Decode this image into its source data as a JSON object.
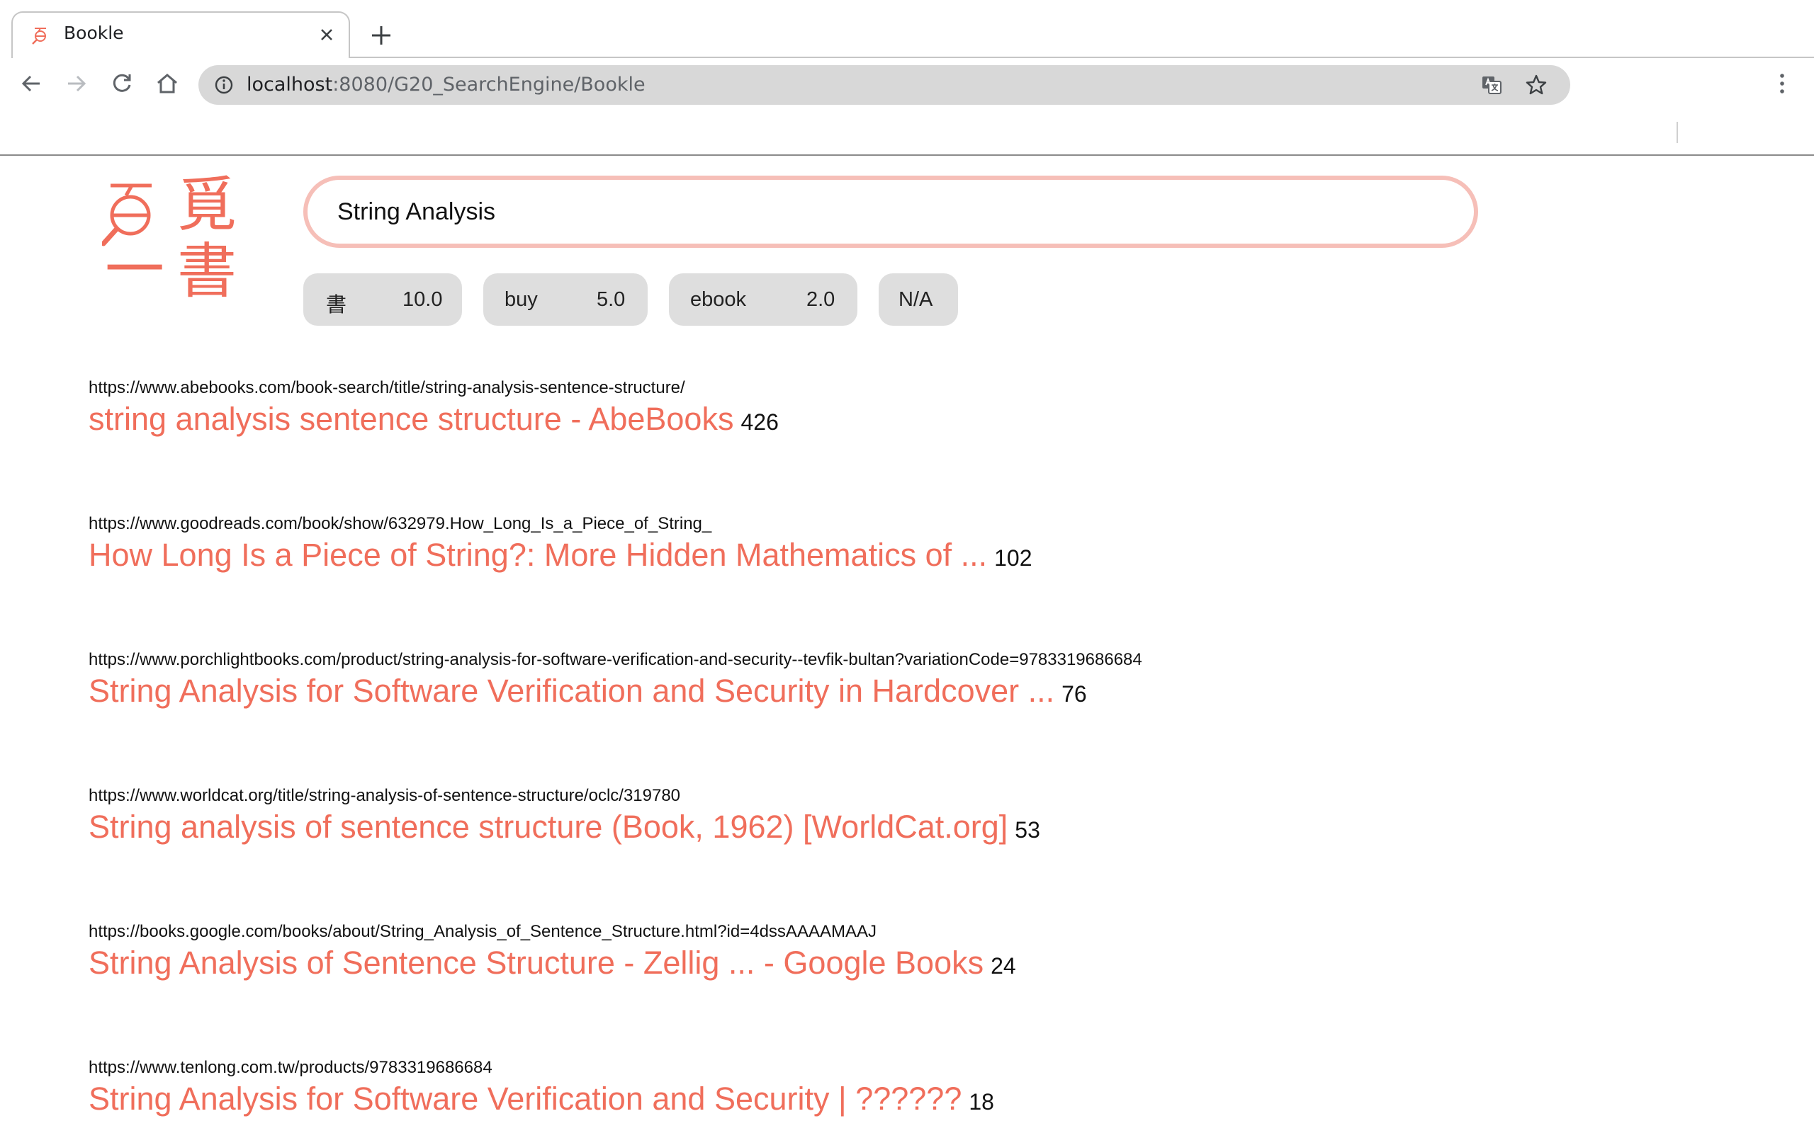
{
  "browser": {
    "tab_title": "Bookle",
    "url_host": "localhost",
    "url_rest": ":8080/G20_SearchEngine/Bookle"
  },
  "search": {
    "query": "String Analysis"
  },
  "logo": {
    "characters": [
      "覓",
      "一",
      "書"
    ],
    "color": "#f06e5b"
  },
  "weights": [
    {
      "label": "書",
      "value": "10.0"
    },
    {
      "label": "buy",
      "value": "5.0"
    },
    {
      "label": "ebook",
      "value": "2.0"
    },
    {
      "label": "N/A",
      "value": ""
    }
  ],
  "results": [
    {
      "url": "https://www.abebooks.com/book-search/title/string-analysis-sentence-structure/",
      "title": "string analysis sentence structure - AbeBooks",
      "count": "426"
    },
    {
      "url": "https://www.goodreads.com/book/show/632979.How_Long_Is_a_Piece_of_String_",
      "title": "How Long Is a Piece of String?: More Hidden Mathematics of ...",
      "count": "102"
    },
    {
      "url": "https://www.porchlightbooks.com/product/string-analysis-for-software-verification-and-security--tevfik-bultan?variationCode=9783319686684",
      "title": "String Analysis for Software Verification and Security in Hardcover ...",
      "count": "76"
    },
    {
      "url": "https://www.worldcat.org/title/string-analysis-of-sentence-structure/oclc/319780",
      "title": "String analysis of sentence structure (Book, 1962) [WorldCat.org]",
      "count": "53"
    },
    {
      "url": "https://books.google.com/books/about/String_Analysis_of_Sentence_Structure.html?id=4dssAAAAMAAJ",
      "title": "String Analysis of Sentence Structure - Zellig ... - Google Books",
      "count": "24"
    },
    {
      "url": "https://www.tenlong.com.tw/products/9783319686684",
      "title": "String Analysis for Software Verification and Security | ??????",
      "count": "18"
    }
  ]
}
